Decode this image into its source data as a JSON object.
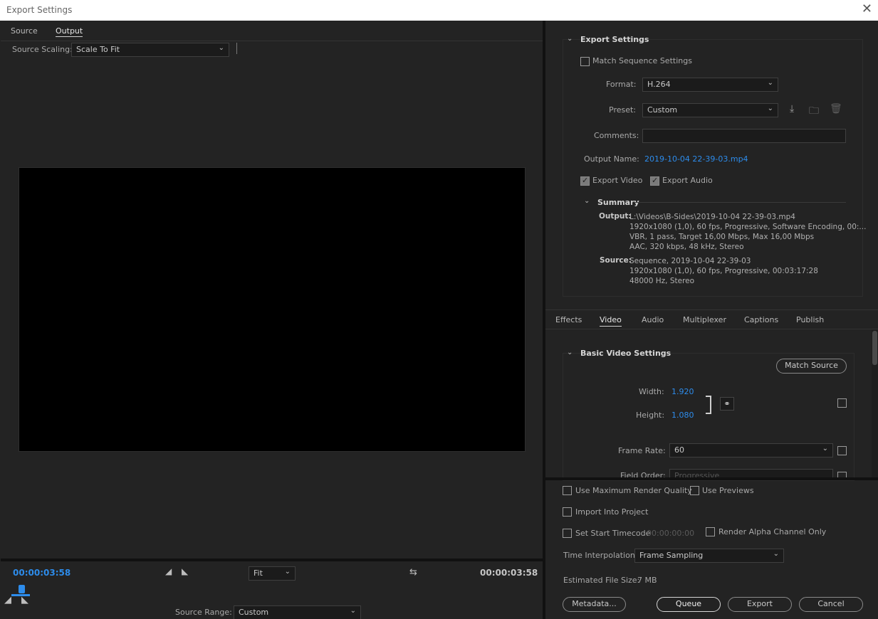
{
  "window": {
    "title": "Export Settings",
    "close": "✕"
  },
  "left": {
    "tabs": [
      "Source",
      "Output"
    ],
    "active_tab": "Output",
    "source_scaling": {
      "label": "Source Scaling:",
      "value": "Scale To Fit"
    },
    "timeline": {
      "current_time": "00:00:03:58",
      "end_time": "00:00:03:58",
      "zoom": "Fit",
      "source_range_label": "Source Range:",
      "source_range_value": "Custom"
    }
  },
  "export_settings": {
    "header": "Export Settings",
    "match_sequence": "Match Sequence Settings",
    "format_label": "Format:",
    "format_value": "H.264",
    "preset_label": "Preset:",
    "preset_value": "Custom",
    "comments_label": "Comments:",
    "comments_value": "",
    "output_name_label": "Output Name:",
    "output_name_value": "2019-10-04 22-39-03.mp4",
    "export_video": "Export Video",
    "export_audio": "Export Audio",
    "summary": {
      "header": "Summary",
      "output_label": "Output:",
      "output_lines": [
        "L:\\Videos\\B-Sides\\2019-10-04 22-39-03.mp4",
        "1920x1080 (1,0), 60 fps, Progressive, Software Encoding, 00:...",
        "VBR, 1 pass, Target 16,00 Mbps, Max 16,00 Mbps",
        "AAC, 320 kbps, 48 kHz, Stereo"
      ],
      "source_label": "Source:",
      "source_lines": [
        "Sequence, 2019-10-04 22-39-03",
        "1920x1080 (1,0), 60 fps, Progressive, 00:03:17:28",
        "48000 Hz, Stereo"
      ]
    }
  },
  "settings_tabs": [
    "Effects",
    "Video",
    "Audio",
    "Multiplexer",
    "Captions",
    "Publish"
  ],
  "active_settings_tab": "Video",
  "video": {
    "header": "Basic Video Settings",
    "match_source": "Match Source",
    "width_label": "Width:",
    "width_value": "1.920",
    "height_label": "Height:",
    "height_value": "1.080",
    "frame_rate_label": "Frame Rate:",
    "frame_rate_value": "60",
    "field_order_label": "Field Order:",
    "field_order_value": "Progressive"
  },
  "bottom": {
    "max_render_quality": "Use Maximum Render Quality",
    "use_previews": "Use Previews",
    "import_into_project": "Import Into Project",
    "set_start_timecode": "Set Start Timecode",
    "start_timecode_value": "00:00:00:00",
    "render_alpha": "Render Alpha Channel Only",
    "time_interpolation_label": "Time Interpolation:",
    "time_interpolation_value": "Frame Sampling",
    "estimated_size_label": "Estimated File Size:",
    "estimated_size_value": "7 MB",
    "metadata": "Metadata...",
    "queue": "Queue",
    "export": "Export",
    "cancel": "Cancel"
  }
}
